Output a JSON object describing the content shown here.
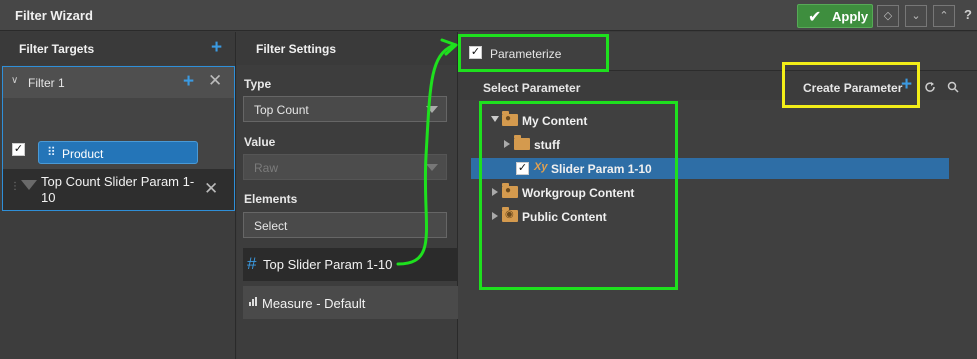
{
  "window": {
    "title": "Filter Wizard"
  },
  "toolbar": {
    "apply_label": "Apply",
    "help_label": "?"
  },
  "filter_targets": {
    "header": "Filter Targets",
    "filter": {
      "name": "Filter 1",
      "product_label": "Product",
      "param_label": "Top Count Slider Param 1-10"
    }
  },
  "filter_settings": {
    "header": "Filter Settings",
    "type_label": "Type",
    "type_value": "Top Count",
    "value_label": "Value",
    "value_value": "Raw",
    "elements_label": "Elements",
    "elements_value": "Select",
    "elements": [
      {
        "label": "Top Slider Param 1-10"
      },
      {
        "label": "Measure - Default"
      }
    ]
  },
  "parameters": {
    "parameterize_label": "Parameterize",
    "parameterize_checked": true,
    "select_label": "Select Parameter",
    "create_label": "Create Parameter",
    "tree": {
      "my_content": "My Content",
      "stuff": "stuff",
      "slider_param": "Slider Param 1-10",
      "workgroup": "Workgroup Content",
      "public": "Public Content"
    }
  },
  "colors": {
    "accent": "#2f8fd8",
    "apply": "#3e8e3e",
    "highlight_green": "#1ee01e",
    "highlight_yellow": "#f3ee18",
    "selected_row": "#2e6ea6"
  }
}
